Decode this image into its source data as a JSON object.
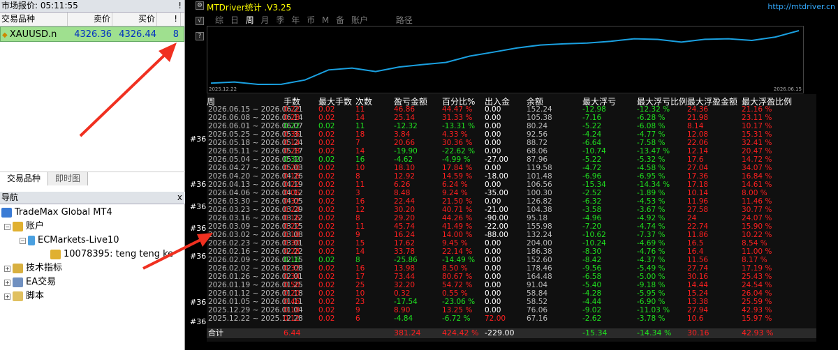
{
  "market_watch": {
    "title": "市场报价: 05:11:55",
    "close": "!",
    "columns": [
      "交易品种",
      "卖价",
      "买价",
      "!"
    ],
    "row": {
      "symbol": "XAUUSD.n",
      "bid": "4326.36",
      "ask": "4326.44",
      "spread": "8"
    },
    "tabs": [
      "交易品种",
      "即时图"
    ]
  },
  "navigator": {
    "title": "导航",
    "close": "x",
    "items": [
      {
        "label": "TradeMax Global MT4"
      },
      {
        "label": "账户"
      },
      {
        "label": "ECMarkets-Live10"
      },
      {
        "label": "10078395: teng teng ke"
      },
      {
        "label": "技术指标"
      },
      {
        "label": "EA交易"
      },
      {
        "label": "脚本"
      }
    ]
  },
  "panel": {
    "title": "MTDriver统计 .V3.25",
    "site": "http://mtdriver.cn",
    "periods": [
      "综",
      "日",
      "周",
      "月",
      "季",
      "年",
      "币",
      "M",
      "备",
      "账户"
    ],
    "active_period": "周",
    "extra": "路径",
    "chart_start": "2025.12.22",
    "chart_end": "2026.06.15",
    "side_marks": [
      "#36",
      "#36",
      "#36",
      "#36",
      "#36",
      "#36",
      "#36"
    ],
    "headers": [
      "周",
      "手数",
      "最大手数",
      "次数",
      "盈亏金额",
      "百分比%",
      "出入金",
      "余额",
      "最大浮亏",
      "最大浮亏比例",
      "最大浮盈金额",
      "最大浮盈比例"
    ],
    "rows": [
      [
        "2026.06.15 ~ 2026.06.21",
        "0.22",
        "0.02",
        "11",
        "46.86",
        "44.47 %",
        "0.00",
        "152.24",
        "-12.98",
        "-12.32 %",
        "24.36",
        "21.16 %"
      ],
      [
        "2026.06.08 ~ 2026.06.14",
        "0.28",
        "0.02",
        "14",
        "25.14",
        "31.33 %",
        "0.00",
        "105.38",
        "-7.16",
        "-6.28 %",
        "21.98",
        "23.11 %"
      ],
      [
        "2026.06.01 ~ 2026.06.07",
        "0.22",
        "0.02",
        "11",
        "-12.32",
        "-13.31 %",
        "0.00",
        "80.24",
        "-5.22",
        "-6.08 %",
        "8.14",
        "10.17 %"
      ],
      [
        "2026.05.25 ~ 2026.05.31",
        "0.36",
        "0.02",
        "18",
        "3.84",
        "4.33 %",
        "0.00",
        "92.56",
        "-4.24",
        "-4.77 %",
        "12.08",
        "15.31 %"
      ],
      [
        "2026.05.18 ~ 2026.05.24",
        "0.14",
        "0.02",
        "7",
        "20.66",
        "30.36 %",
        "0.00",
        "88.72",
        "-6.64",
        "-7.58 %",
        "22.06",
        "32.41 %"
      ],
      [
        "2026.05.11 ~ 2026.05.17",
        "0.28",
        "0.02",
        "14",
        "-19.90",
        "-22.62 %",
        "0.00",
        "68.06",
        "-10.74",
        "-13.47 %",
        "12.14",
        "20.47 %"
      ],
      [
        "2026.05.04 ~ 2026.05.10",
        "0.32",
        "0.02",
        "16",
        "-4.62",
        "-4.99 %",
        "-27.00",
        "87.96",
        "-5.22",
        "-5.32 %",
        "17.6",
        "14.72 %"
      ],
      [
        "2026.04.27 ~ 2026.05.03",
        "0.20",
        "0.02",
        "10",
        "18.10",
        "17.84 %",
        "0.00",
        "119.58",
        "-4.72",
        "-4.58 %",
        "27.04",
        "34.07 %"
      ],
      [
        "2026.04.20 ~ 2026.04.26",
        "0.16",
        "0.02",
        "8",
        "12.92",
        "14.59 %",
        "-18.00",
        "101.48",
        "-6.96",
        "-6.95 %",
        "17.36",
        "16.84 %"
      ],
      [
        "2026.04.13 ~ 2026.04.19",
        "0.22",
        "0.02",
        "11",
        "6.26",
        "6.24 %",
        "0.00",
        "106.56",
        "-15.34",
        "-14.34 %",
        "17.18",
        "14.61 %"
      ],
      [
        "2026.04.06 ~ 2026.04.12",
        "0.06",
        "0.02",
        "3",
        "8.48",
        "9.24 %",
        "-35.00",
        "100.30",
        "-2.52",
        "-1.89 %",
        "10.14",
        "8.00 %"
      ],
      [
        "2026.03.30 ~ 2026.04.05",
        "0.32",
        "0.02",
        "16",
        "22.44",
        "21.50 %",
        "0.00",
        "126.82",
        "-6.32",
        "-4.53 %",
        "11.96",
        "11.46 %"
      ],
      [
        "2026.03.23 ~ 2026.03.29",
        "0.24",
        "0.02",
        "12",
        "30.20",
        "40.71 %",
        "-21.00",
        "104.38",
        "-3.58",
        "-3.67 %",
        "27.58",
        "30.77 %"
      ],
      [
        "2026.03.16 ~ 2026.03.22",
        "0.16",
        "0.02",
        "8",
        "29.20",
        "44.26 %",
        "-90.00",
        "95.18",
        "-4.96",
        "-4.92 %",
        "24",
        "24.07 %"
      ],
      [
        "2026.03.09 ~ 2026.03.15",
        "0.22",
        "0.02",
        "11",
        "45.74",
        "41.49 %",
        "-22.00",
        "155.98",
        "-7.20",
        "-4.74 %",
        "22.74",
        "15.90 %"
      ],
      [
        "2026.03.02 ~ 2026.03.08",
        "0.18",
        "0.02",
        "9",
        "16.24",
        "14.00 %",
        "-88.00",
        "132.24",
        "-10.62",
        "-7.37 %",
        "11.86",
        "10.22 %"
      ],
      [
        "2026.02.23 ~ 2026.03.01",
        "0.30",
        "0.02",
        "15",
        "17.62",
        "9.45 %",
        "0.00",
        "204.00",
        "-10.24",
        "-4.69 %",
        "16.5",
        "8.54 %"
      ],
      [
        "2026.02.16 ~ 2026.02.22",
        "0.28",
        "0.02",
        "14",
        "33.78",
        "22.14 %",
        "0.00",
        "186.38",
        "-8.30",
        "-4.76 %",
        "16.4",
        "11.00 %"
      ],
      [
        "2026.02.09 ~ 2026.02.15",
        "0.16",
        "0.02",
        "8",
        "-25.86",
        "-14.49 %",
        "0.00",
        "152.60",
        "-8.42",
        "-4.37 %",
        "11.56",
        "8.17 %"
      ],
      [
        "2026.02.02 ~ 2026.02.08",
        "0.32",
        "0.02",
        "16",
        "13.98",
        "8.50 %",
        "0.00",
        "178.46",
        "-9.56",
        "-5.49 %",
        "27.74",
        "17.19 %"
      ],
      [
        "2026.01.26 ~ 2026.02.01",
        "0.34",
        "0.02",
        "17",
        "73.44",
        "80.67 %",
        "0.00",
        "164.48",
        "-6.58",
        "-5.00 %",
        "30.16",
        "25.43 %"
      ],
      [
        "2026.01.19 ~ 2026.01.25",
        "0.50",
        "0.02",
        "25",
        "32.20",
        "54.72 %",
        "0.00",
        "91.04",
        "-5.40",
        "-9.18 %",
        "14.44",
        "24.54 %"
      ],
      [
        "2026.01.12 ~ 2026.01.18",
        "0.20",
        "0.02",
        "10",
        "0.32",
        "0.55 %",
        "0.00",
        "58.84",
        "-4.28",
        "-5.95 %",
        "15.24",
        "26.04 %"
      ],
      [
        "2026.01.05 ~ 2026.01.11",
        "0.46",
        "0.02",
        "23",
        "-17.54",
        "-23.06 %",
        "0.00",
        "58.52",
        "-4.44",
        "-6.90 %",
        "13.38",
        "25.59 %"
      ],
      [
        "2025.12.29 ~ 2026.01.04",
        "0.18",
        "0.02",
        "9",
        "8.90",
        "13.25 %",
        "0.00",
        "76.06",
        "-9.02",
        "-11.03 %",
        "27.94",
        "42.93 %"
      ],
      [
        "2025.12.22 ~ 2025.12.28",
        "0.12",
        "0.02",
        "6",
        "-4.84",
        "-6.72 %",
        "72.00",
        "67.16",
        "-2.62",
        "-3.78 %",
        "10.6",
        "15.97 %"
      ]
    ],
    "total": [
      "合计",
      "6.44",
      "",
      "",
      "381.24",
      "424.42 %",
      "-229.00",
      "",
      "-15.34",
      "-14.34 %",
      "30.16",
      "42.93 %"
    ],
    "colors": {
      "pos": "#ff2020",
      "neg": "#20e020",
      "neutral": "#ffffff",
      "line": "#1aa0e0"
    }
  },
  "chart_data": {
    "type": "line",
    "x": [
      "2025.12.22",
      "2025.12.29",
      "2026.01.05",
      "2026.01.12",
      "2026.01.19",
      "2026.01.26",
      "2026.02.02",
      "2026.02.09",
      "2026.02.16",
      "2026.02.23",
      "2026.03.02",
      "2026.03.09",
      "2026.03.16",
      "2026.03.23",
      "2026.03.30",
      "2026.04.06",
      "2026.04.13",
      "2026.04.20",
      "2026.04.27",
      "2026.05.04",
      "2026.05.11",
      "2026.05.18",
      "2026.05.25",
      "2026.06.01",
      "2026.06.08",
      "2026.06.15"
    ],
    "series": [
      {
        "values": [
          -4.84,
          4.06,
          -13.48,
          -13.16,
          19.04,
          92.48,
          106.46,
          80.6,
          114.38,
          132.0,
          148.24,
          193.98,
          223.18,
          253.38,
          275.82,
          284.3,
          290.56,
          303.48,
          321.58,
          316.96,
          297.06,
          317.72,
          321.56,
          309.24,
          334.38,
          381.24
        ]
      }
    ],
    "xlabel": "",
    "ylabel": ""
  }
}
